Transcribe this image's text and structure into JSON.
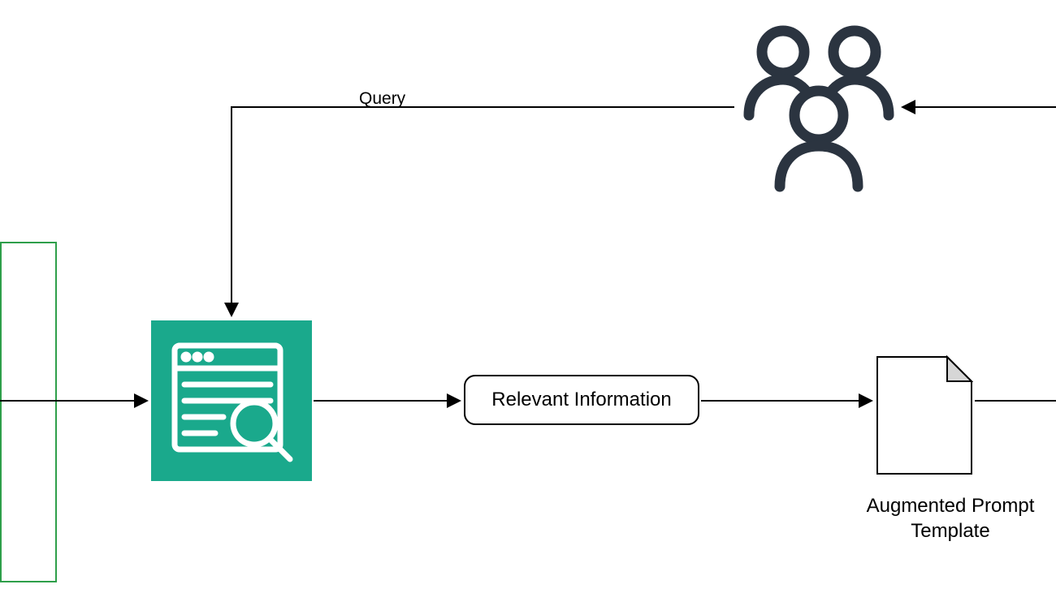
{
  "nodes": {
    "relevant_info": "Relevant Information",
    "augmented_prompt": "Augmented Prompt\nTemplate"
  },
  "edges": {
    "query": "Query"
  },
  "colors": {
    "retrieval_bg": "#1aa98c",
    "green_border": "#2e9f4a",
    "icon_stroke": "#2b3440"
  }
}
